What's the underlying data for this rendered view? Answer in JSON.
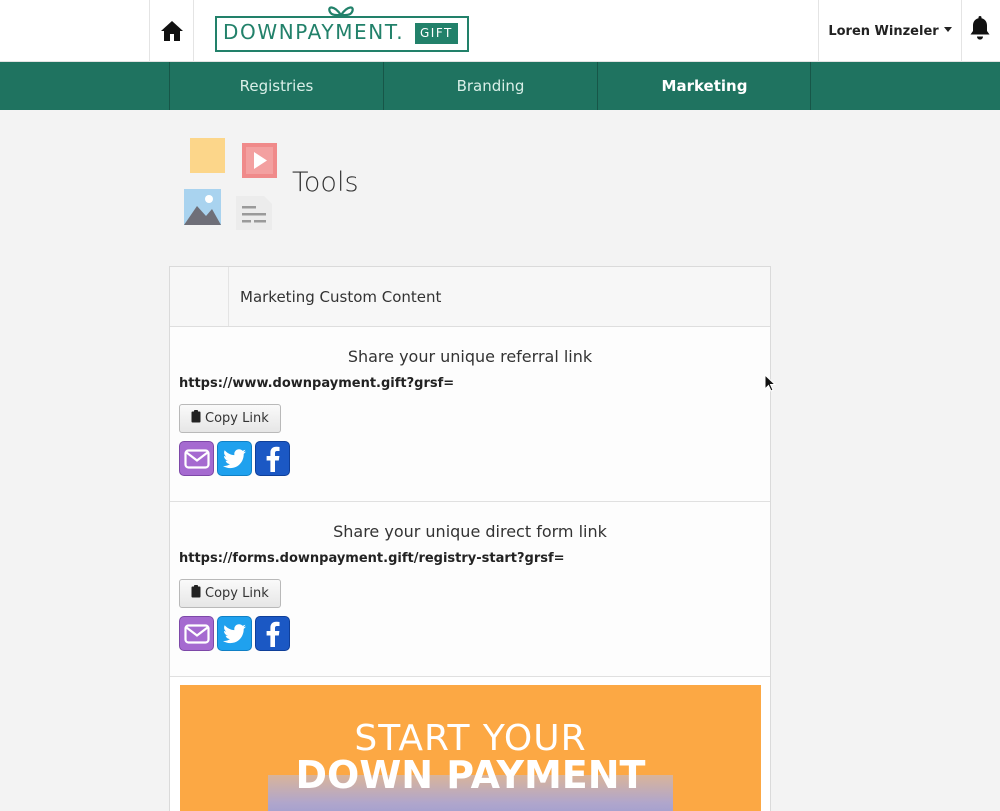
{
  "header": {
    "logo_text": "DOWNPAYMENT.",
    "logo_gift": "GIFT",
    "user_name": "Loren Winzeler"
  },
  "nav": {
    "tabs": [
      {
        "label": "Registries"
      },
      {
        "label": "Branding"
      },
      {
        "label": "Marketing",
        "active": true
      }
    ]
  },
  "page": {
    "title": "Tools"
  },
  "panel": {
    "title": "Marketing Custom Content",
    "sections": [
      {
        "heading": "Share your unique referral link",
        "link": "https://www.downpayment.gift?grsf=",
        "copy_label": "Copy Link"
      },
      {
        "heading": "Share your unique direct form link",
        "link": "https://forms.downpayment.gift/registry-start?grsf=",
        "copy_label": "Copy Link"
      }
    ],
    "promo": {
      "line1": "START YOUR",
      "line2": "DOWN PAYMENT"
    }
  },
  "colors": {
    "brand_green": "#22816a",
    "nav_green": "#1f7360",
    "email": "#a56ad0",
    "twitter": "#1fa1ee",
    "facebook": "#1b58c4",
    "promo_orange": "#fca844"
  },
  "icons": [
    "home-icon",
    "bell-icon",
    "clipboard-icon",
    "email-icon",
    "twitter-icon",
    "facebook-icon",
    "mouse-cursor-icon"
  ]
}
